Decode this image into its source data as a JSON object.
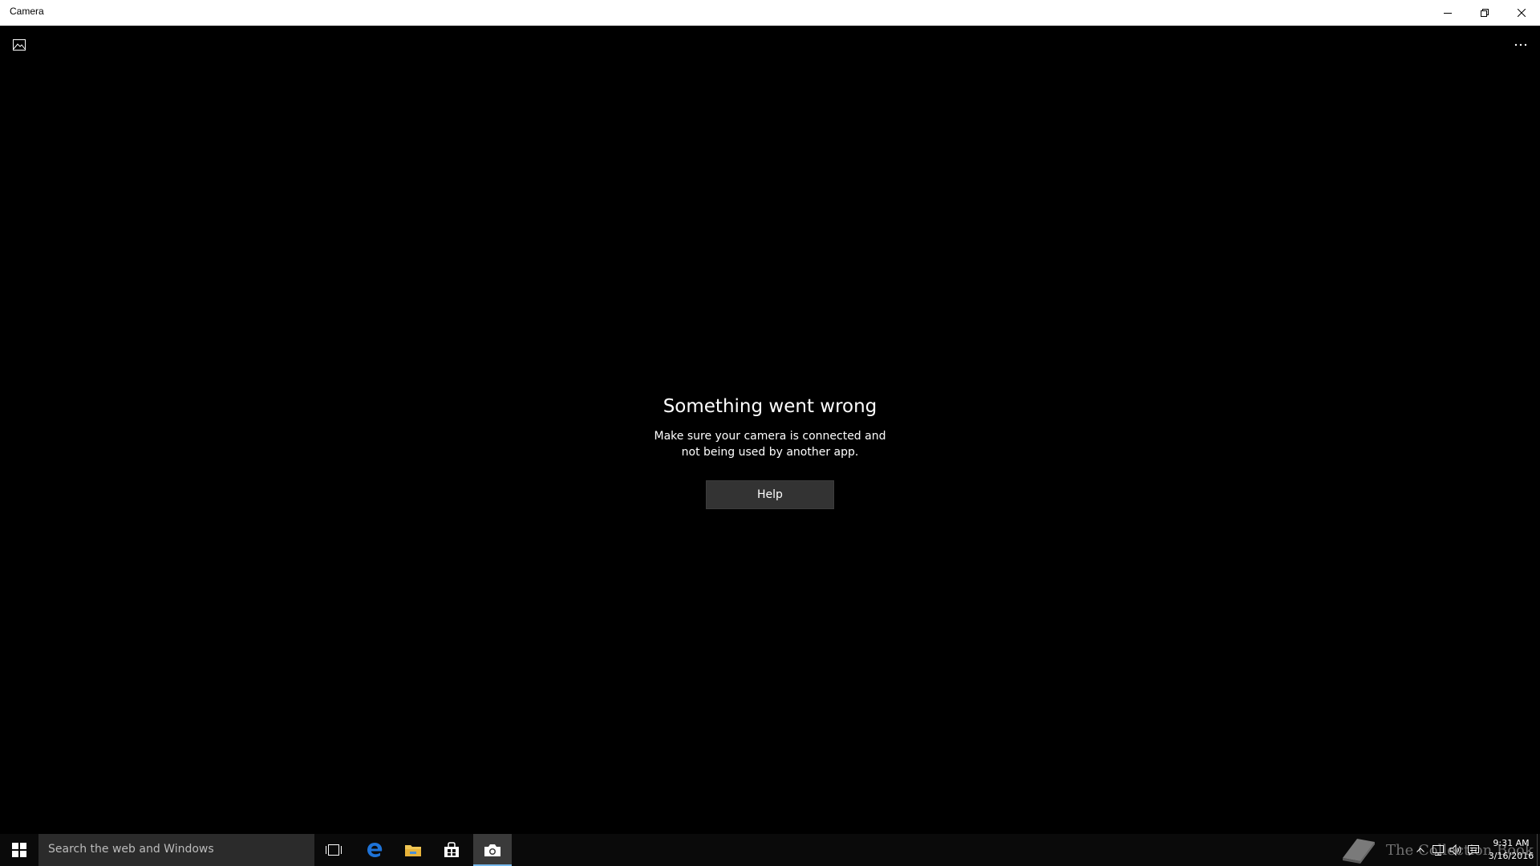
{
  "window": {
    "title": "Camera"
  },
  "toolbar": {
    "gallery_icon": "gallery-icon",
    "more_icon": "more-options-icon"
  },
  "error": {
    "title": "Something went wrong",
    "message": "Make sure your camera is connected and not being used by another app.",
    "help_label": "Help"
  },
  "taskbar": {
    "search_placeholder": "Search the web and Windows",
    "pinned": [
      "task-view-icon",
      "edge-icon",
      "file-explorer-icon",
      "store-icon",
      "camera-icon"
    ],
    "active_app": "Camera",
    "accent_color": "#76b9ed",
    "watermark": "The Collection Book",
    "clock": {
      "time": "9:31 AM",
      "date": "3/16/2016"
    }
  },
  "colors": {
    "titlebar": "#ffffff",
    "background": "#000000",
    "button": "#333333",
    "taskbar": "#0a0a0a"
  }
}
